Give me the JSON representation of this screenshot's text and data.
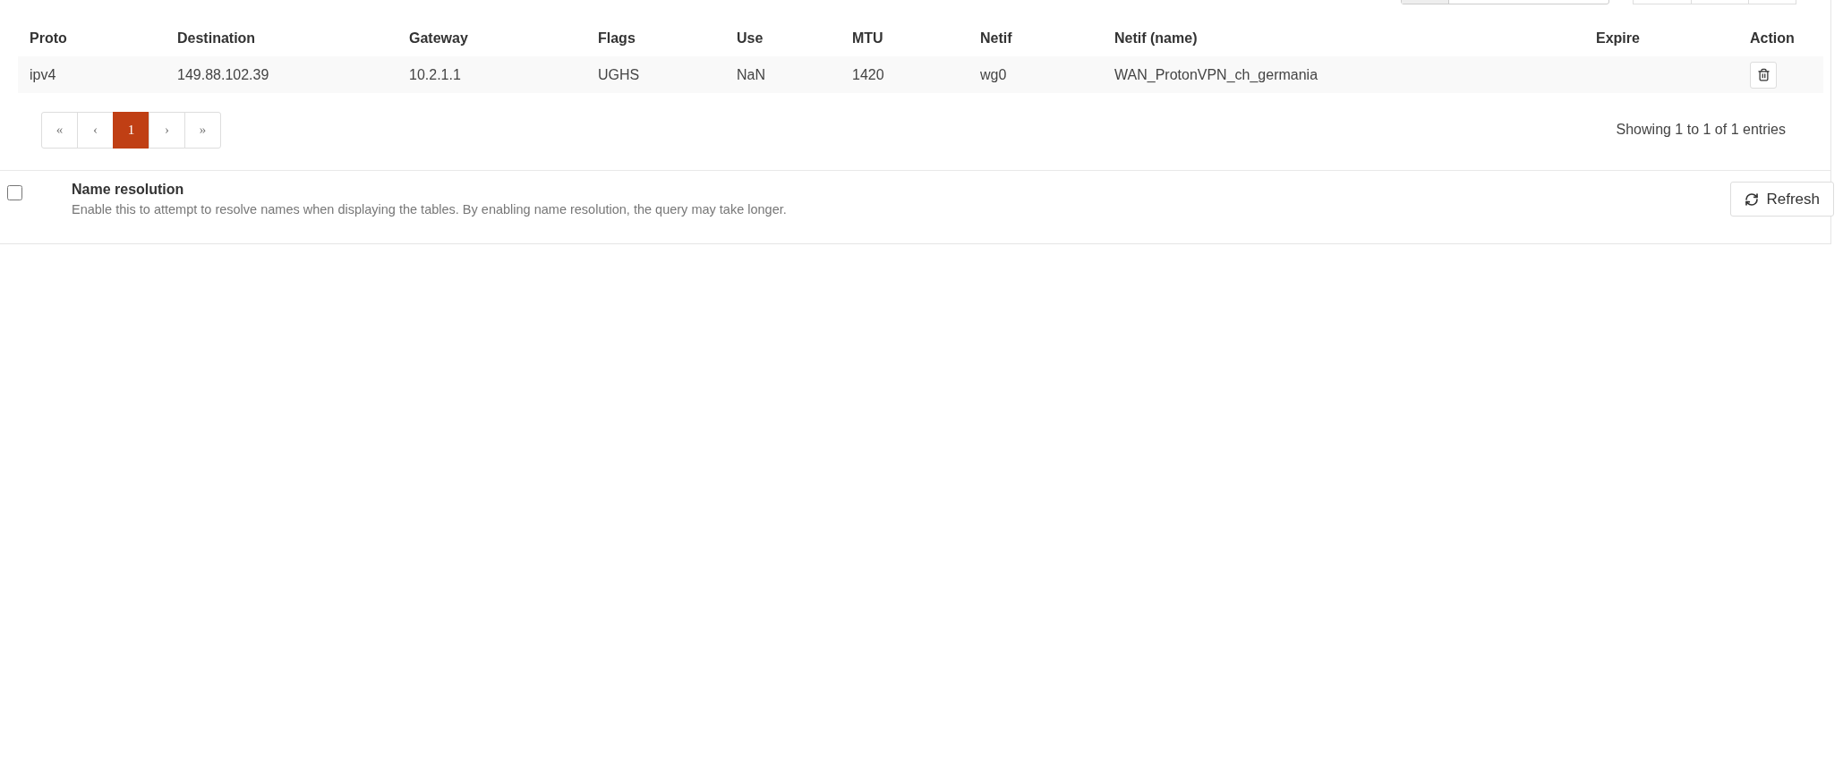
{
  "table": {
    "columns": [
      "Proto",
      "Destination",
      "Gateway",
      "Flags",
      "Use",
      "MTU",
      "Netif",
      "Netif (name)",
      "Expire",
      "Action"
    ],
    "rows": [
      {
        "cells": [
          "ipv4",
          "149.88.102.39",
          "10.2.1.1",
          "UGHS",
          "NaN",
          "1420",
          "wg0",
          "WAN_ProtonVPN_ch_germania"
        ],
        "deletable": true
      }
    ]
  },
  "pagination": [
    {
      "label": "«",
      "selected": false
    },
    {
      "label": "‹",
      "selected": false
    },
    {
      "label": "1",
      "selected": true
    },
    {
      "label": "›",
      "selected": false
    },
    {
      "label": "»",
      "selected": false
    }
  ],
  "entries_info": "Showing 1 to 1 of 1 entries",
  "name_resolution": {
    "checked": false,
    "label": "Name resolution",
    "description": "Enable this to attempt to resolve names when displaying the tables. By enabling name resolution, the query may take longer."
  },
  "refresh_button": "Refresh"
}
